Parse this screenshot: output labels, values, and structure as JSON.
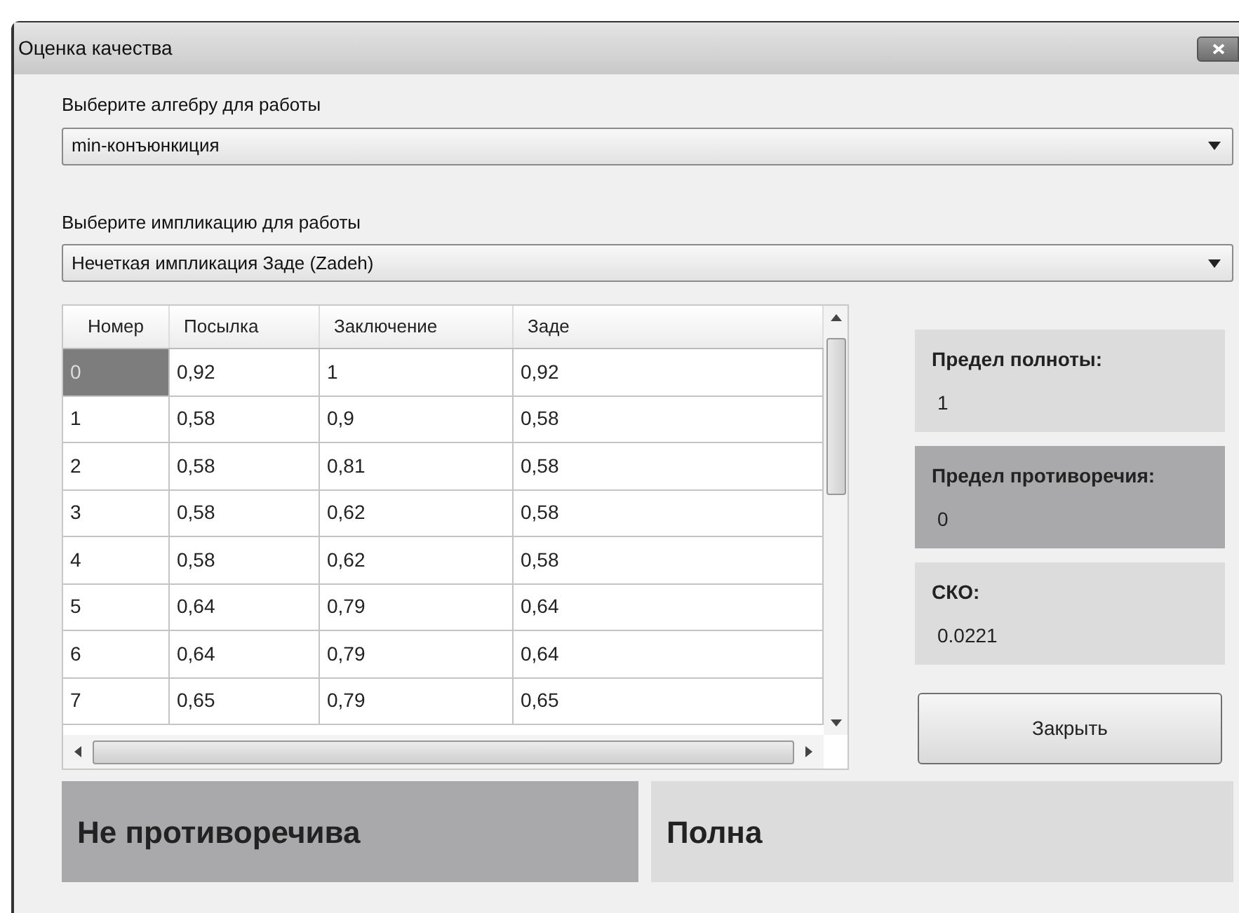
{
  "window": {
    "title": "Оценка качества"
  },
  "algebra": {
    "label": "Выберите алгебру для работы",
    "value": "min-конъюнкиция"
  },
  "implication": {
    "label": "Выберите импликацию для работы",
    "value": "Нечеткая импликация Заде (Zadeh)"
  },
  "table": {
    "columns": [
      "Номер",
      "Посылка",
      "Заключение",
      "Заде"
    ],
    "rows": [
      {
        "selected": true,
        "cells": [
          "0",
          "0,92",
          "1",
          "0,92"
        ]
      },
      {
        "selected": false,
        "cells": [
          "1",
          "0,58",
          "0,9",
          "0,58"
        ]
      },
      {
        "selected": false,
        "cells": [
          "2",
          "0,58",
          "0,81",
          "0,58"
        ]
      },
      {
        "selected": false,
        "cells": [
          "3",
          "0,58",
          "0,62",
          "0,58"
        ]
      },
      {
        "selected": false,
        "cells": [
          "4",
          "0,58",
          "0,62",
          "0,58"
        ]
      },
      {
        "selected": false,
        "cells": [
          "5",
          "0,64",
          "0,79",
          "0,64"
        ]
      },
      {
        "selected": false,
        "cells": [
          "6",
          "0,64",
          "0,79",
          "0,64"
        ]
      },
      {
        "selected": false,
        "cells": [
          "7",
          "0,65",
          "0,79",
          "0,65"
        ]
      }
    ]
  },
  "stats": [
    {
      "label": "Предел полноты:",
      "value": "1",
      "highlighted": false
    },
    {
      "label": "Предел противоречия:",
      "value": "0",
      "highlighted": true
    },
    {
      "label": "СКО:",
      "value": "0.0221",
      "highlighted": false
    }
  ],
  "close_button": "Закрыть",
  "results": [
    {
      "text": "Не противоречива",
      "highlighted": true
    },
    {
      "text": "Полна",
      "highlighted": false
    }
  ]
}
